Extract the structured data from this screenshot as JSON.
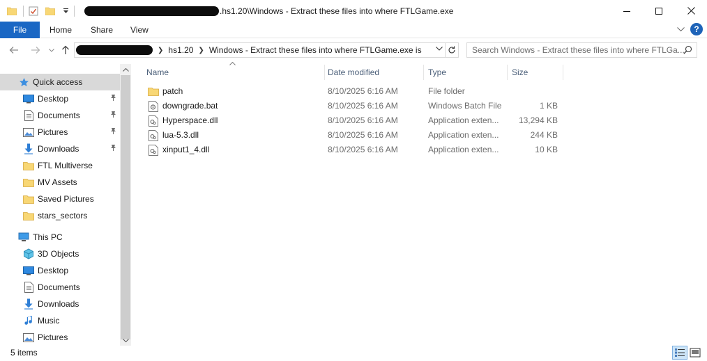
{
  "window": {
    "title_suffix": ".hs1.20\\Windows - Extract these files into where FTLGame.exe"
  },
  "ribbon": {
    "tabs": [
      "File",
      "Home",
      "Share",
      "View"
    ]
  },
  "address": {
    "crumbs": [
      "hs1.20",
      "Windows - Extract these files into where FTLGame.exe is"
    ],
    "search_placeholder": "Search Windows - Extract these files into where FTLGa..."
  },
  "nav": {
    "quick_access": "Quick access",
    "items": [
      {
        "label": "Desktop",
        "icon": "desktop-icon",
        "pinned": true
      },
      {
        "label": "Documents",
        "icon": "documents-icon",
        "pinned": true
      },
      {
        "label": "Pictures",
        "icon": "pictures-icon",
        "pinned": true
      },
      {
        "label": "Downloads",
        "icon": "downloads-icon",
        "pinned": true
      },
      {
        "label": "FTL Multiverse",
        "icon": "folder-icon",
        "pinned": false
      },
      {
        "label": "MV Assets",
        "icon": "folder-icon",
        "pinned": false
      },
      {
        "label": "Saved Pictures",
        "icon": "folder-icon",
        "pinned": false
      },
      {
        "label": "stars_sectors",
        "icon": "folder-icon",
        "pinned": false
      }
    ],
    "this_pc": "This PC",
    "pc_items": [
      {
        "label": "3D Objects",
        "icon": "3d-objects-icon"
      },
      {
        "label": "Desktop",
        "icon": "desktop-icon"
      },
      {
        "label": "Documents",
        "icon": "documents-icon"
      },
      {
        "label": "Downloads",
        "icon": "downloads-icon"
      },
      {
        "label": "Music",
        "icon": "music-icon"
      },
      {
        "label": "Pictures",
        "icon": "pictures-icon"
      }
    ]
  },
  "columns": {
    "name": "Name",
    "date": "Date modified",
    "type": "Type",
    "size": "Size"
  },
  "files": [
    {
      "name": "patch",
      "date": "8/10/2025 6:16 AM",
      "type": "File folder",
      "size": "",
      "icon": "folder-icon"
    },
    {
      "name": "downgrade.bat",
      "date": "8/10/2025 6:16 AM",
      "type": "Windows Batch File",
      "size": "1 KB",
      "icon": "batch-file-icon"
    },
    {
      "name": "Hyperspace.dll",
      "date": "8/10/2025 6:16 AM",
      "type": "Application exten...",
      "size": "13,294 KB",
      "icon": "dll-file-icon"
    },
    {
      "name": "lua-5.3.dll",
      "date": "8/10/2025 6:16 AM",
      "type": "Application exten...",
      "size": "244 KB",
      "icon": "dll-file-icon"
    },
    {
      "name": "xinput1_4.dll",
      "date": "8/10/2025 6:16 AM",
      "type": "Application exten...",
      "size": "10 KB",
      "icon": "dll-file-icon"
    }
  ],
  "status": {
    "item_count": "5 items"
  },
  "colors": {
    "accent": "#1a67c4",
    "folder": "#f8d775",
    "selected_nav": "#d9d9d9"
  }
}
